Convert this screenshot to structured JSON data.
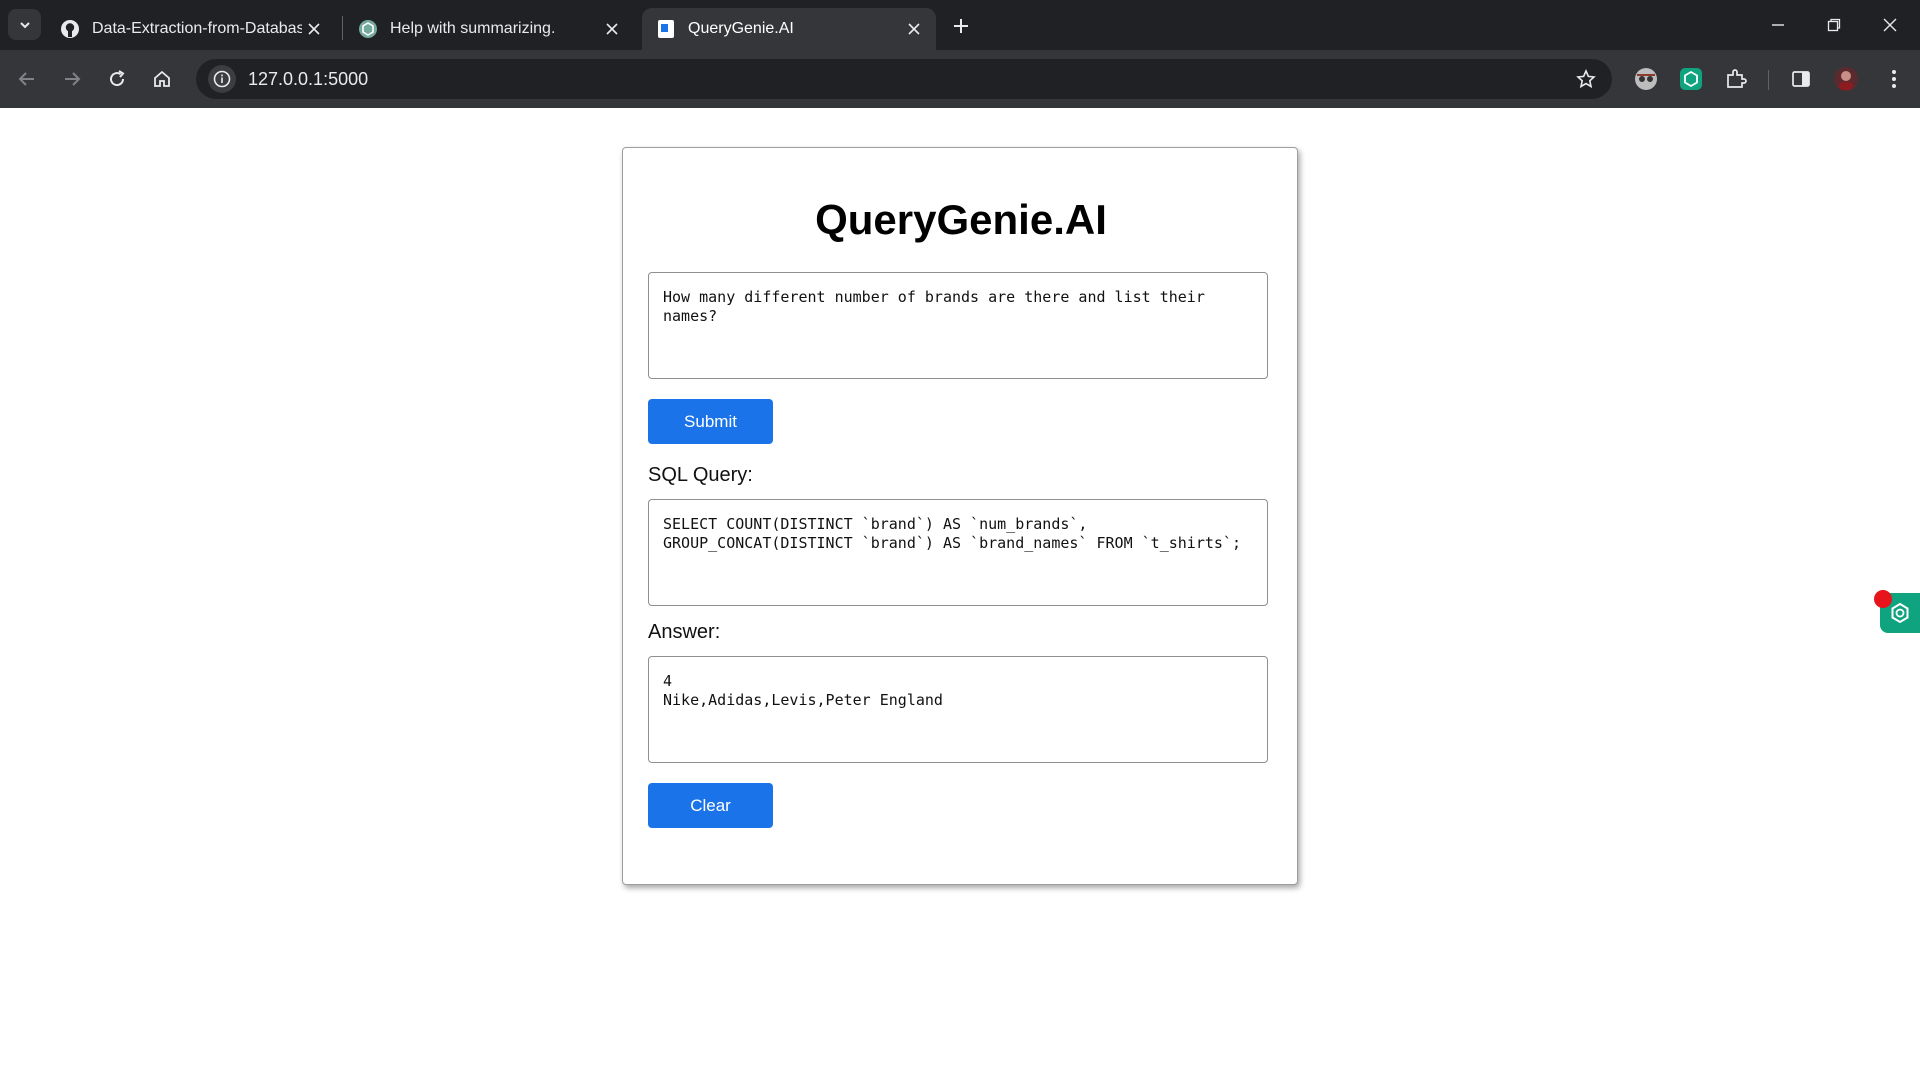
{
  "browser": {
    "tabs": [
      {
        "title": "Data-Extraction-from-Database",
        "favicon": "github-icon",
        "active": false
      },
      {
        "title": "Help with summarizing.",
        "favicon": "chatgpt-icon",
        "active": false
      },
      {
        "title": "QueryGenie.AI",
        "favicon": "document-icon",
        "active": true
      }
    ],
    "url": "127.0.0.1:5000"
  },
  "page": {
    "title": "QueryGenie.AI",
    "question": "How many different number of brands are there and list their names?",
    "submit_label": "Submit",
    "sql_label": "SQL Query:",
    "sql_query": "SELECT COUNT(DISTINCT `brand`) AS `num_brands`, GROUP_CONCAT(DISTINCT `brand`) AS `brand_names` FROM `t_shirts`;",
    "answer_label": "Answer:",
    "answer": "4\nNike,Adidas,Levis,Peter England",
    "clear_label": "Clear"
  },
  "colors": {
    "button": "#1a73e8",
    "tabbar": "#202124",
    "toolbar": "#35363a"
  }
}
